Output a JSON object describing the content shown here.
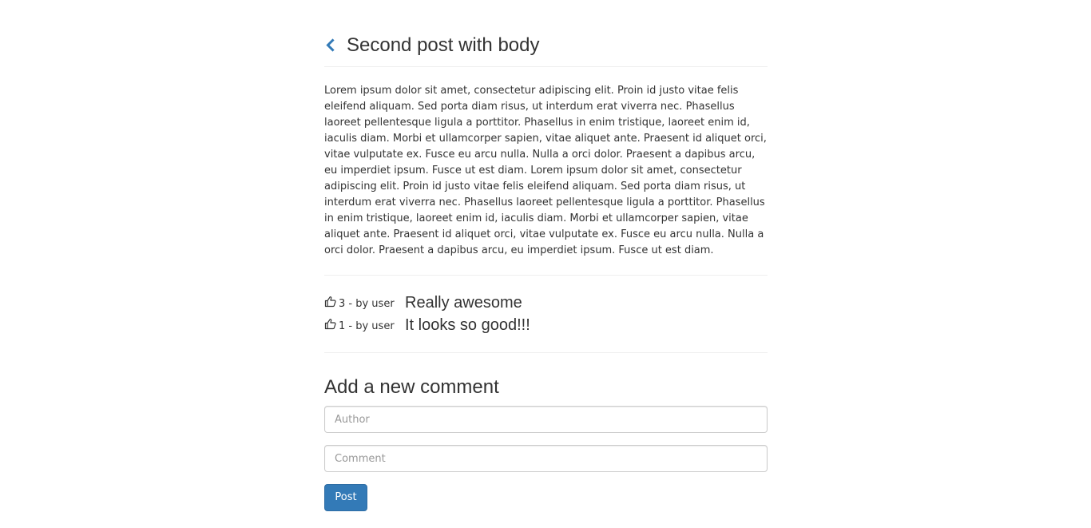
{
  "post": {
    "title": "Second post with body",
    "back_icon": "chevron-left-icon",
    "body": "Lorem ipsum dolor sit amet, consectetur adipiscing elit. Proin id justo vitae felis eleifend aliquam. Sed porta diam risus, ut interdum erat viverra nec. Phasellus laoreet pellentesque ligula a porttitor. Phasellus in enim tristique, laoreet enim id, iaculis diam. Morbi et ullamcorper sapien, vitae aliquet ante. Praesent id aliquet orci, vitae vulputate ex. Fusce eu arcu nulla. Nulla a orci dolor. Praesent a dapibus arcu, eu imperdiet ipsum. Fusce ut est diam. Lorem ipsum dolor sit amet, consectetur adipiscing elit. Proin id justo vitae felis eleifend aliquam. Sed porta diam risus, ut interdum erat viverra nec. Phasellus laoreet pellentesque ligula a porttitor. Phasellus in enim tristique, laoreet enim id, iaculis diam. Morbi et ullamcorper sapien, vitae aliquet ante. Praesent id aliquet orci, vitae vulputate ex. Fusce eu arcu nulla. Nulla a orci dolor. Praesent a dapibus arcu, eu imperdiet ipsum. Fusce ut est diam."
  },
  "comments": [
    {
      "meta": "3 - by user",
      "text": "Really awesome",
      "icon": "thumbs-up-icon"
    },
    {
      "meta": "1 - by user",
      "text": "It looks so good!!!",
      "icon": "thumbs-up-icon"
    }
  ],
  "form": {
    "title": "Add a new comment",
    "author": {
      "value": "",
      "placeholder": "Author"
    },
    "comment": {
      "value": "",
      "placeholder": "Comment"
    },
    "submit_label": "Post"
  },
  "colors": {
    "accent": "#337ab7",
    "text": "#333333",
    "divider": "#eeeeee"
  }
}
